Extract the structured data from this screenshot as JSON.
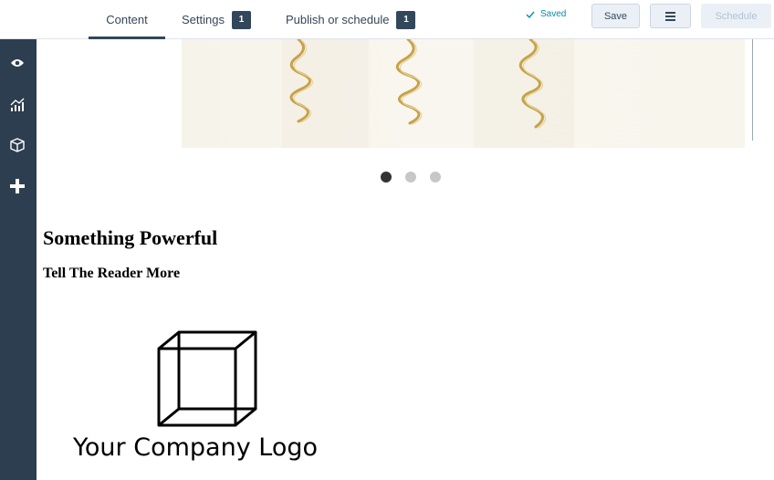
{
  "header": {
    "tabs": [
      {
        "label": "Content",
        "badge": ""
      },
      {
        "label": "Settings",
        "badge": "1"
      },
      {
        "label": "Publish or schedule",
        "badge": "1"
      }
    ],
    "saved_label": "Saved",
    "save_label": "Save",
    "schedule_label": "Schedule",
    "menu_icon": "hamburger-icon"
  },
  "sidebar": {
    "icons": [
      "eye-icon",
      "analytics-icon",
      "cube-icon",
      "plus-icon"
    ]
  },
  "content": {
    "carousel": {
      "slide_count": 3,
      "active_index": 0
    },
    "heading": "Something Powerful",
    "subheading": "Tell The Reader More",
    "logo_text": "Your Company Logo"
  },
  "colors": {
    "sidebar_bg": "#2d3e50",
    "accent": "#33475b",
    "saved": "#0091ae",
    "ribbon_gold": "#c7a248"
  }
}
